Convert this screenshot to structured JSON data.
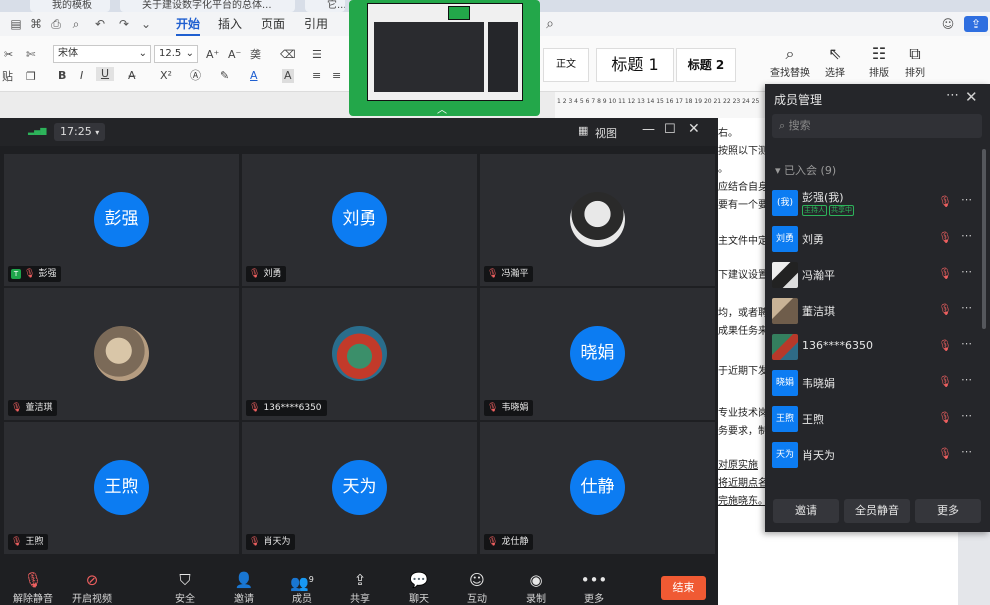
{
  "doc": {
    "tabs": [
      "我的模板",
      "关于建设数字化平台的总体...",
      "它..."
    ],
    "menu": [
      "开始",
      "插入",
      "页面",
      "引用"
    ],
    "active_menu": "开始",
    "font_name": "宋体",
    "font_size": "12.5",
    "styles": [
      "正文",
      "标题 1",
      "标题 2"
    ],
    "tools": {
      "find": "查找替换",
      "select": "选择",
      "layout": "排版",
      "arrange": "排列",
      "paste": "贴"
    },
    "ruler": "1 2 3 4 5 6 7 8 9 10 11 12 13 14 15 16 17 18 19 20 21 22 23 24 25",
    "lines": [
      "右。",
      "按照以下测",
      "。",
      "应结合自身",
      "要有一个要",
      "主文件中定",
      "下建议设置",
      "均，或者聘",
      "成果任务来",
      "于近期下发",
      "专业技术岗",
      "务要求，制",
      "对原实施",
      "将近期点名",
      "完施晓东。"
    ]
  },
  "meeting": {
    "signal": "▂▄▆",
    "time": "17:25",
    "view_label": "视图",
    "participants": [
      {
        "name": "彭强",
        "avatar_text": "彭强",
        "host": true,
        "host_mark": "T"
      },
      {
        "name": "刘勇",
        "avatar_text": "刘勇"
      },
      {
        "name": "冯瀚平",
        "avatar_text": ""
      },
      {
        "name": "董洁琪",
        "avatar_text": ""
      },
      {
        "name": "136****6350",
        "avatar_text": ""
      },
      {
        "name": "韦晓娟",
        "avatar_text": "晓娟"
      },
      {
        "name": "王煦",
        "avatar_text": "王煦"
      },
      {
        "name": "肖天为",
        "avatar_text": "天为"
      },
      {
        "name": "龙仕静",
        "avatar_text": "仕静"
      }
    ],
    "toolbar": {
      "unmute": "解除静音",
      "start_video": "开启视频",
      "security": "安全",
      "invite": "邀请",
      "members": "成员",
      "member_count": "9",
      "share": "共享",
      "chat": "聊天",
      "interact": "互动",
      "record": "录制",
      "more": "更多",
      "end": "结束"
    }
  },
  "panel": {
    "title": "成员管理",
    "search_placeholder": "搜索",
    "joined": "已入会 (9)",
    "members": [
      {
        "avatar": "(我)",
        "name": "彭强(我)",
        "tags": [
          "主持人",
          "共享中"
        ]
      },
      {
        "avatar": "刘勇",
        "name": "刘勇"
      },
      {
        "avatar": "",
        "name": "冯瀚平"
      },
      {
        "avatar": "",
        "name": "董洁琪"
      },
      {
        "avatar": "",
        "name": "136****6350"
      },
      {
        "avatar": "晓娟",
        "name": "韦晓娟"
      },
      {
        "avatar": "王煦",
        "name": "王煦"
      },
      {
        "avatar": "天为",
        "name": "肖天为"
      }
    ],
    "buttons": [
      "邀请",
      "全员静音",
      "更多"
    ]
  },
  "colors": {
    "avatar_blue": "#0c7cf2",
    "end_red": "#f05a33",
    "mute_red": "#f06060",
    "host_green": "#1ea54b",
    "thumb_green": "#23a74a"
  }
}
